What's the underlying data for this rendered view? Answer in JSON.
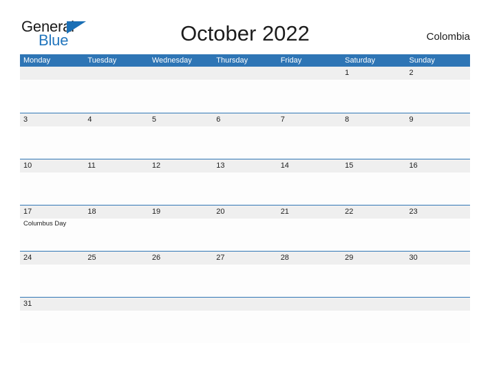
{
  "brand": {
    "logo_part1": "General",
    "logo_part2": "Blue",
    "logo_triangle_icon": "triangle-icon",
    "colors": {
      "header_blue": "#2e75b5",
      "logo_blue": "#2175bd",
      "day_band_gray": "#efefef",
      "text_dark": "#1c1c1c"
    }
  },
  "header": {
    "title": "October 2022",
    "country": "Colombia"
  },
  "calendar": {
    "weekdays": [
      "Monday",
      "Tuesday",
      "Wednesday",
      "Thursday",
      "Friday",
      "Saturday",
      "Sunday"
    ],
    "weeks": [
      [
        {
          "day": ""
        },
        {
          "day": ""
        },
        {
          "day": ""
        },
        {
          "day": ""
        },
        {
          "day": ""
        },
        {
          "day": "1"
        },
        {
          "day": "2"
        }
      ],
      [
        {
          "day": "3"
        },
        {
          "day": "4"
        },
        {
          "day": "5"
        },
        {
          "day": "6"
        },
        {
          "day": "7"
        },
        {
          "day": "8"
        },
        {
          "day": "9"
        }
      ],
      [
        {
          "day": "10"
        },
        {
          "day": "11"
        },
        {
          "day": "12"
        },
        {
          "day": "13"
        },
        {
          "day": "14"
        },
        {
          "day": "15"
        },
        {
          "day": "16"
        }
      ],
      [
        {
          "day": "17",
          "event": "Columbus Day"
        },
        {
          "day": "18"
        },
        {
          "day": "19"
        },
        {
          "day": "20"
        },
        {
          "day": "21"
        },
        {
          "day": "22"
        },
        {
          "day": "23"
        }
      ],
      [
        {
          "day": "24"
        },
        {
          "day": "25"
        },
        {
          "day": "26"
        },
        {
          "day": "27"
        },
        {
          "day": "28"
        },
        {
          "day": "29"
        },
        {
          "day": "30"
        }
      ],
      [
        {
          "day": "31"
        },
        {
          "day": ""
        },
        {
          "day": ""
        },
        {
          "day": ""
        },
        {
          "day": ""
        },
        {
          "day": ""
        },
        {
          "day": ""
        }
      ]
    ]
  }
}
